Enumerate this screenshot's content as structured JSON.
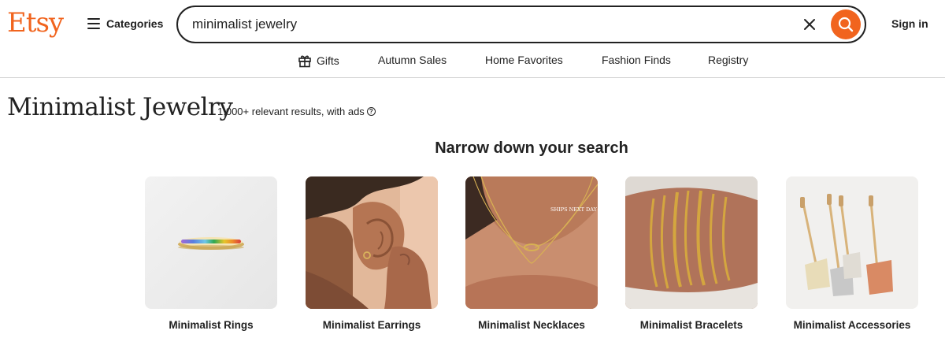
{
  "header": {
    "logo": "Etsy",
    "categories_label": "Categories",
    "search_value": "minimalist jewelry",
    "signin_label": "Sign in"
  },
  "subnav": {
    "items": [
      "Gifts",
      "Autumn Sales",
      "Home Favorites",
      "Fashion Finds",
      "Registry"
    ]
  },
  "page": {
    "title": "Minimalist Jewelry",
    "results_text": "1,000+ relevant results, with ads",
    "narrow_heading": "Narrow down your search"
  },
  "cards": [
    {
      "label": "Minimalist Rings"
    },
    {
      "label": "Minimalist Earrings"
    },
    {
      "label": "Minimalist Necklaces",
      "badge": "SHIPS NEXT DAY"
    },
    {
      "label": "Minimalist Bracelets"
    },
    {
      "label": "Minimalist Accessories"
    }
  ],
  "colors": {
    "brand": "#f1641e",
    "text": "#222222"
  }
}
